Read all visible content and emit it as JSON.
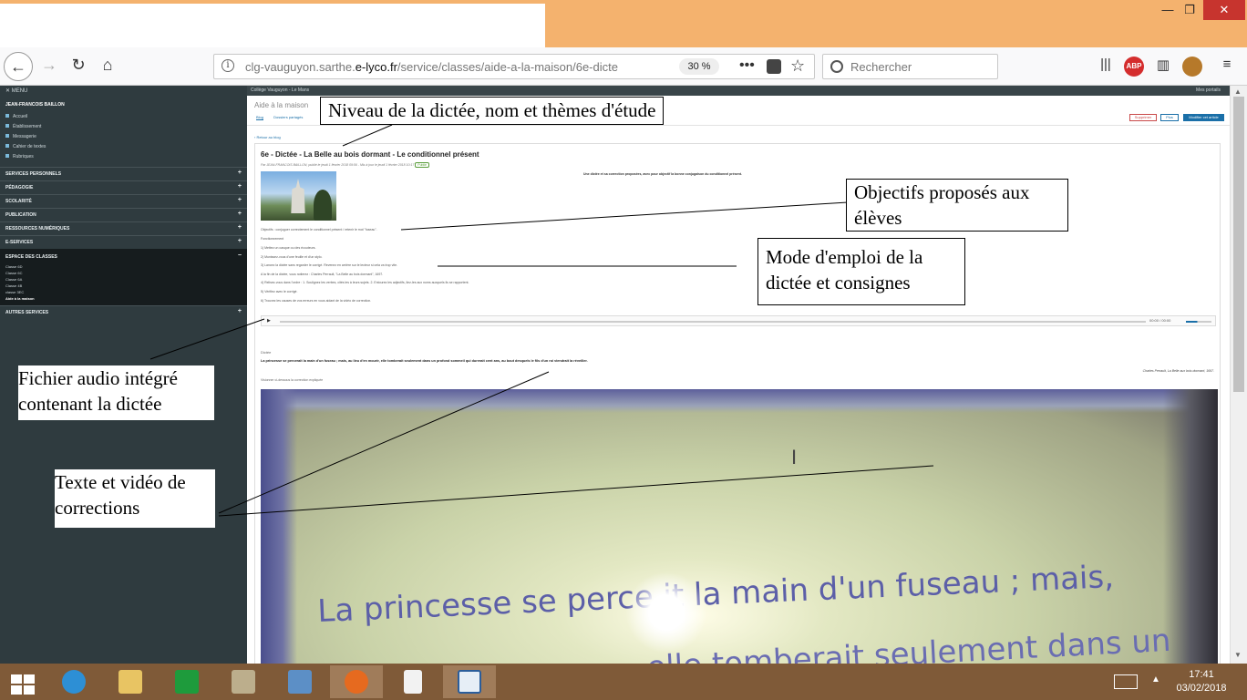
{
  "browser": {
    "url_prefix": "clg-vauguyon.sarthe.",
    "url_domain": "e-lyco.fr",
    "url_path": "/service/classes/aide-a-la-maison/6e-dicte",
    "zoom": "30 %",
    "search_placeholder": "Rechercher",
    "abp_label": "ABP"
  },
  "sidebar": {
    "menu_label": "MENU",
    "user_name": "JEAN-FRANCOIS BAILLON",
    "links": [
      "Accueil",
      "Établissement",
      "Messagerie",
      "Cahier de textes",
      "Rubriques"
    ],
    "sections": [
      "SERVICES PERSONNELS",
      "PÉDAGOGIE",
      "SCOLARITÉ",
      "PUBLICATION",
      "RESSOURCES NUMÉRIQUES",
      "E-SERVICES"
    ],
    "classes_section": "ESPACE DES CLASSES",
    "classes": [
      "Classe 6D",
      "Classe 6C",
      "Classe 6A",
      "Classe 4B",
      "classe 3EC",
      "Aide à la maison"
    ],
    "other_section": "AUTRES SERVICES"
  },
  "topstrip": {
    "school": "Collège Vauguyon - Le Mans",
    "portals": "Mes portails"
  },
  "main": {
    "page_title": "Aide à la maison",
    "tabs": [
      "Blog",
      "Dossiers partagés"
    ],
    "btn_delete": "Supprimer",
    "btn_plus": "Plus",
    "btn_edit": "Modifier cet article",
    "back_link": "‹ Retour au blog"
  },
  "article": {
    "title": "6e - Dictée - La Belle au bois dormant - Le conditionnel présent",
    "meta": "Par JEAN-FRANCOIS BAILLON, publié le jeudi 1 février 2018 09:56 - Mis à jour le jeudi 1 février 2018 10:17",
    "badge": "Publié",
    "intro": "Une dictée et sa correction proposées, avec pour objectif la bonne conjugaison du conditionnel présent.",
    "objective": "Objectifs : conjuguer correctement le conditionnel présent / retenir le mot \"fuseau\".",
    "procedure_title": "Fonctionnement",
    "steps": [
      "1) Mettez un casque ou des écouteurs.",
      "2) Munissez-vous d'une feuille et d'un stylo.",
      "3) Lancez la dictée sans regarder le corrigé. Revenez en arrière sur le lecteur si cela va trop vite.",
      "A la fin de la dictée, vous notierez : Charles Perrault, \"La Belle au bois dormant\", 1697.",
      "4) Relisez-vous dans l'ordre : 1. Soulignez les verbes, cités les à leurs sujets. 2. Entourez les adjectifs, liez-les aux noms auxquels ils se rapportent.",
      "5) Vérifiez avec le corrigé.",
      "6) Trouvez les causes de vos erreurs en vous aidant de la vidéo de correction."
    ],
    "audio_time": "00:00 / 00:00",
    "dictee_label": "Dictée",
    "dictee_text": "La princesse se percerait la main d'un fuseau ; mais, au lieu d'en mourir, elle tomberait seulement dans un profond sommeil qui durerait cent ans, au bout desquels le fils d'un roi viendrait la réveiller.",
    "dictee_author": "Charles Perrault, La Belle aux bois dormant, 1697.",
    "video_label": "Visionner ci-dessous la correction expliquée",
    "video_line1": "La princesse se perce   it la main d'un fuseau ; mais,",
    "video_line2": "... elle tomberait seulement dans un"
  },
  "annotations": {
    "niveau": "Niveau de la dictée, nom et thèmes d'étude",
    "objectifs_1": "Objectifs proposés aux",
    "objectifs_2": "élèves",
    "mode_1": "Mode d'emploi de la",
    "mode_2": "dictée et consignes",
    "audio_1": "Fichier audio intégré",
    "audio_2": "contenant la dictée",
    "texte_1": "Texte et vidéo de",
    "texte_2": "corrections"
  },
  "taskbar": {
    "time": "17:41",
    "date": "03/02/2018"
  },
  "colors": {
    "titlebar": "#f4b26e",
    "sidebar": "#2f3b3f",
    "accent": "#1a6fa8",
    "taskbar": "#7f5a38",
    "close": "#c7342e"
  }
}
